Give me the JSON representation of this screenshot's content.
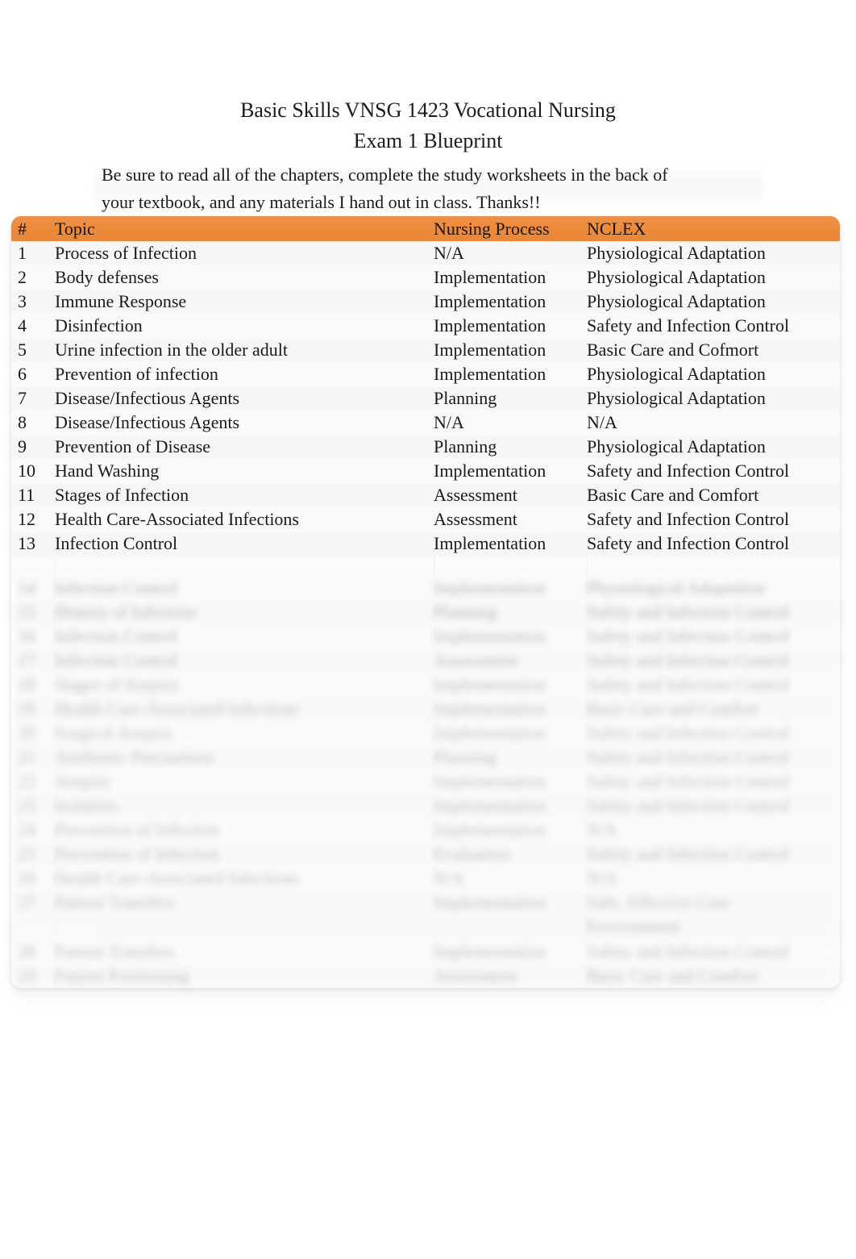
{
  "document": {
    "title_line_1": "Basic Skills VNSG 1423 Vocational Nursing",
    "title_line_2": "Exam 1 Blueprint",
    "intro_line_1": "Be sure to read all of the chapters, complete the study worksheets in the back of",
    "intro_line_2": "your textbook, and any materials I hand out in class. Thanks!!"
  },
  "colors": {
    "header_orange": "#ED8B3A",
    "page_background": "#FFFFFF",
    "table_background": "#FBFBFB",
    "text": "#1A1A1A"
  },
  "table": {
    "columns": [
      {
        "key": "num",
        "label": "#"
      },
      {
        "key": "topic",
        "label": "Topic"
      },
      {
        "key": "proc",
        "label": "Nursing Process"
      },
      {
        "key": "nclex",
        "label": "NCLEX"
      }
    ],
    "rows": [
      {
        "num": "1",
        "topic": "Process of Infection",
        "proc": "N/A",
        "nclex": "Physiological Adaptation",
        "blurred": false
      },
      {
        "num": "2",
        "topic": "Body defenses",
        "proc": "Implementation",
        "nclex": "Physiological Adaptation",
        "blurred": false
      },
      {
        "num": "3",
        "topic": "Immune Response",
        "proc": "Implementation",
        "nclex": "Physiological Adaptation",
        "blurred": false
      },
      {
        "num": "4",
        "topic": "Disinfection",
        "proc": "Implementation",
        "nclex": "Safety and Infection Control",
        "blurred": false
      },
      {
        "num": "5",
        "topic": "Urine infection in the older adult",
        "proc": "Implementation",
        "nclex": "Basic Care and Cofmort",
        "blurred": false
      },
      {
        "num": "6",
        "topic": "Prevention of infection",
        "proc": "Implementation",
        "nclex": "Physiological Adaptation",
        "blurred": false
      },
      {
        "num": "7",
        "topic": "Disease/Infectious Agents",
        "proc": "Planning",
        "nclex": "Physiological Adaptation",
        "blurred": false
      },
      {
        "num": "8",
        "topic": "Disease/Infectious Agents",
        "proc": "N/A",
        "nclex": "N/A",
        "blurred": false
      },
      {
        "num": "9",
        "topic": "Prevention of Disease",
        "proc": "Planning",
        "nclex": "Physiological Adaptation",
        "blurred": false
      },
      {
        "num": "10",
        "topic": "Hand Washing",
        "proc": "Implementation",
        "nclex": "Safety and Infection Control",
        "blurred": false
      },
      {
        "num": "11",
        "topic": "Stages of Infection",
        "proc": "Assessment",
        "nclex": "Basic Care and Comfort",
        "blurred": false
      },
      {
        "num": "12",
        "topic": "Health Care-Associated Infections",
        "proc": "Assessment",
        "nclex": "Safety and Infection Control",
        "blurred": false
      },
      {
        "num": "13",
        "topic": "Infection Control",
        "proc": "Implementation",
        "nclex": "Safety and Infection Control",
        "blurred": false
      },
      {
        "num": "14",
        "topic": "Infection Control",
        "proc": "Implementation",
        "nclex": "Physiological Adaptation",
        "blurred": true
      },
      {
        "num": "15",
        "topic": "History of Infection",
        "proc": "Planning",
        "nclex": "Safety and Infection Control",
        "blurred": true
      },
      {
        "num": "16",
        "topic": "Infection Control",
        "proc": "Implementation",
        "nclex": "Safety and Infection Control",
        "blurred": true
      },
      {
        "num": "17",
        "topic": "Infection Control",
        "proc": "Assessment",
        "nclex": "Safety and Infection Control",
        "blurred": true
      },
      {
        "num": "18",
        "topic": "Stages of Asepsis",
        "proc": "Implementation",
        "nclex": "Safety and Infection Control",
        "blurred": true
      },
      {
        "num": "19",
        "topic": "Health Care-Associated Infections",
        "proc": "Implementation",
        "nclex": "Basic Care and Comfort",
        "blurred": true
      },
      {
        "num": "20",
        "topic": "Surgical Asepsis",
        "proc": "Implementation",
        "nclex": "Safety and Infection Control",
        "blurred": true
      },
      {
        "num": "21",
        "topic": "Antibiotic Precautions",
        "proc": "Planning",
        "nclex": "Safety and Infection Control",
        "blurred": true
      },
      {
        "num": "22",
        "topic": "Asepsis",
        "proc": "Implementation",
        "nclex": "Safety and Infection Control",
        "blurred": true
      },
      {
        "num": "23",
        "topic": "Isolation",
        "proc": "Implementation",
        "nclex": "Safety and Infection Control",
        "blurred": true
      },
      {
        "num": "24",
        "topic": "Prevention of Infection",
        "proc": "Implementation",
        "nclex": "N/A",
        "blurred": true
      },
      {
        "num": "25",
        "topic": "Prevention of Infection",
        "proc": "Evaluation",
        "nclex": "Safety and Infection Control",
        "blurred": true
      },
      {
        "num": "26",
        "topic": "Health Care-Associated Infections",
        "proc": "N/A",
        "nclex": "N/A",
        "blurred": true
      },
      {
        "num": "27",
        "topic": "Patient Transfers",
        "proc": "Implementation",
        "nclex": "Safe, Effective Care",
        "nclex_line2": "Environment",
        "blurred": true,
        "tall": true
      },
      {
        "num": "28",
        "topic": "Patient Transfers",
        "proc": "Implementation",
        "nclex": "Safety and Infection Control",
        "blurred": true
      },
      {
        "num": "29",
        "topic": "Patient Positioning",
        "proc": "Assessment",
        "nclex": "Basic Care and Comfort",
        "blurred": true
      }
    ]
  }
}
